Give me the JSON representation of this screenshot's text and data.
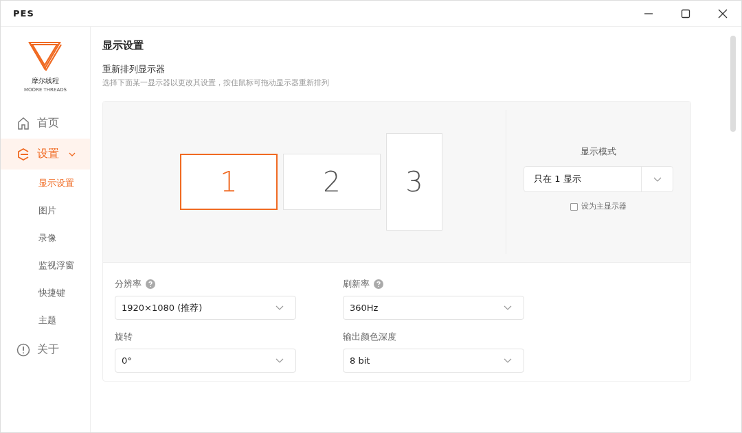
{
  "window": {
    "title": "PES"
  },
  "logo": {
    "name": "摩尔线程",
    "tagline": "MOORE THREADS"
  },
  "sidebar": {
    "items": [
      {
        "label": "首页",
        "kind": "home",
        "selected": false
      },
      {
        "label": "设置",
        "kind": "settings",
        "selected": true,
        "expanded": true,
        "children": [
          {
            "label": "显示设置",
            "selected": true
          },
          {
            "label": "图片",
            "selected": false
          },
          {
            "label": "录像",
            "selected": false
          },
          {
            "label": "监视浮窗",
            "selected": false
          },
          {
            "label": "快捷键",
            "selected": false
          },
          {
            "label": "主题",
            "selected": false
          }
        ]
      },
      {
        "label": "关于",
        "kind": "about",
        "selected": false
      }
    ]
  },
  "page": {
    "title": "显示设置",
    "section_title": "重新排列显示器",
    "section_hint": "选择下面某一显示器以更改其设置，按住鼠标可拖动显示器重新排列"
  },
  "monitors": [
    {
      "label": "1",
      "kind": "landscape",
      "selected": true
    },
    {
      "label": "2",
      "kind": "landscape",
      "selected": false
    },
    {
      "label": "3",
      "kind": "portrait",
      "selected": false
    }
  ],
  "display_mode": {
    "label": "显示模式",
    "value": "只在 1 显示",
    "primary_label": "设为主显示器",
    "primary_checked": false
  },
  "fields": [
    {
      "label": "分辨率",
      "help": true,
      "value": "1920×1080 (推荐)"
    },
    {
      "label": "刷新率",
      "help": true,
      "value": "360Hz"
    },
    {
      "label": "旋转",
      "help": false,
      "value": "0°"
    },
    {
      "label": "输出颜色深度",
      "help": false,
      "value": "8 bit"
    }
  ]
}
